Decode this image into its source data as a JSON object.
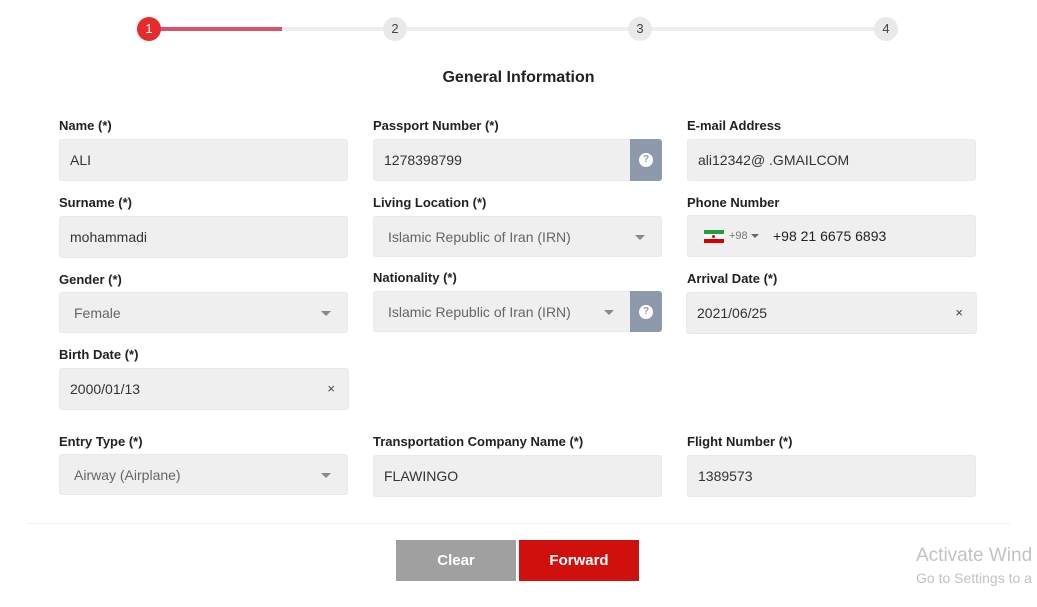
{
  "stepper": {
    "steps": [
      "1",
      "2",
      "3",
      "4"
    ],
    "active_index": 0,
    "progress_fraction": 0.18
  },
  "section_title": "General Information",
  "form": {
    "name": {
      "label": "Name (*)",
      "value": "ALI"
    },
    "surname": {
      "label": "Surname (*)",
      "value": "mohammadi"
    },
    "gender": {
      "label": "Gender (*)",
      "value": "Female"
    },
    "birth_date": {
      "label": "Birth Date (*)",
      "value": "2000/01/13",
      "clear": "×"
    },
    "passport_number": {
      "label": "Passport Number (*)",
      "value": "1278398799",
      "help_icon": "question-circle-icon"
    },
    "living_location": {
      "label": "Living Location (*)",
      "value": "Islamic Republic of Iran (IRN)"
    },
    "nationality": {
      "label": "Nationality (*)",
      "value": "Islamic Republic of Iran (IRN)",
      "help_icon": "question-circle-icon"
    },
    "email": {
      "label": "E-mail Address",
      "value": "ali12342@ .GMAILCOM"
    },
    "phone": {
      "label": "Phone Number",
      "country_code": "+98",
      "value": "+98 21 6675 6893",
      "flag_icon": "iran-flag-icon"
    },
    "arrival_date": {
      "label": "Arrival Date (*)",
      "value": "2021/06/25",
      "clear": "×"
    },
    "entry_type": {
      "label": "Entry Type (*)",
      "value": "Airway (Airplane)"
    },
    "transportation_company": {
      "label": "Transportation Company Name (*)",
      "value": "FLAWINGO"
    },
    "flight_number": {
      "label": "Flight Number (*)",
      "value": "1389573"
    }
  },
  "actions": {
    "clear_label": "Clear",
    "forward_label": "Forward"
  },
  "watermark": {
    "line1": "Activate Wind",
    "line2": "Go to Settings to a"
  },
  "colors": {
    "accent": "#e52b2b",
    "progress": "#d9526a",
    "forward": "#d0100d",
    "clear": "#a0a0a0",
    "help": "#8e9aab"
  }
}
